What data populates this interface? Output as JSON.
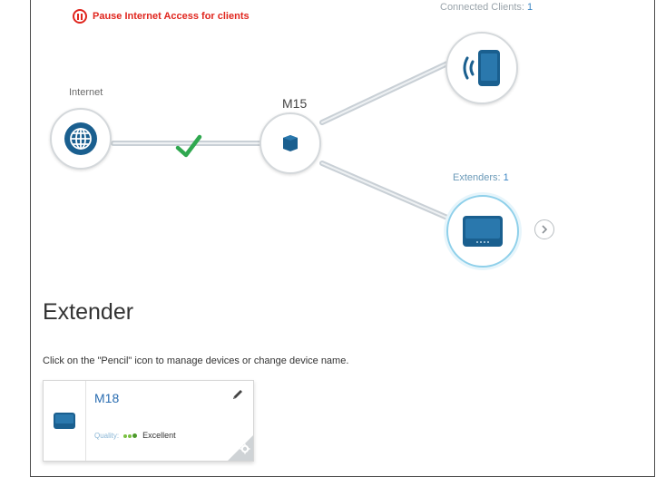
{
  "pause_access": {
    "label": "Pause Internet Access for clients"
  },
  "topology": {
    "internet": {
      "label": "Internet",
      "icon": "globe-icon"
    },
    "router": {
      "name": "M15",
      "icon": "mesh-router-icon"
    },
    "clients": {
      "label": "Connected Clients:",
      "count": "1",
      "icon": "mobile-device-icon"
    },
    "extenders": {
      "label": "Extenders:",
      "count": "1",
      "icon": "extender-device-icon"
    },
    "status_icon": "checkmark-icon"
  },
  "extender_section": {
    "title": "Extender",
    "instruction": "Click on the \"Pencil\" icon to manage devices or change device name.",
    "device": {
      "name": "M18",
      "quality_label": "Quality:",
      "quality_value": "Excellent"
    }
  },
  "colors": {
    "accent": "#3c86c4",
    "alert": "#e0261e",
    "success": "#2fa84f",
    "device": "#1a5f8f"
  }
}
